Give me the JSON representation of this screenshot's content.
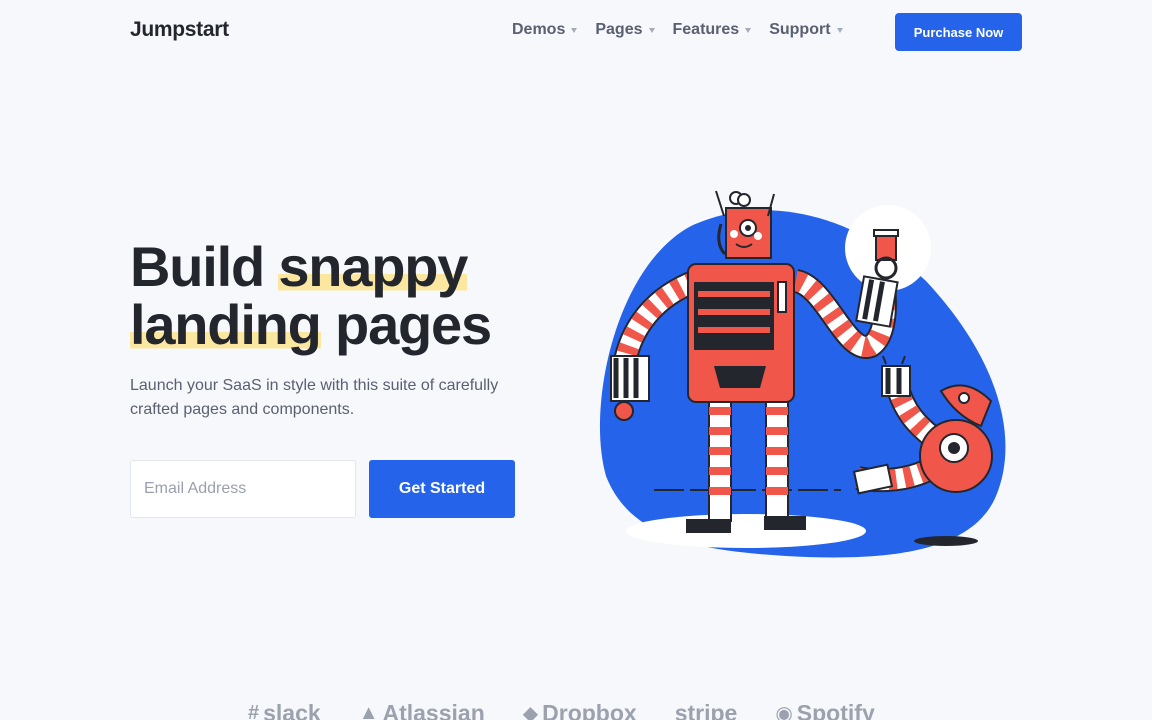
{
  "header": {
    "logo": "Jumpstart",
    "nav": [
      {
        "label": "Demos"
      },
      {
        "label": "Pages"
      },
      {
        "label": "Features"
      },
      {
        "label": "Support"
      }
    ],
    "cta_label": "Purchase Now"
  },
  "hero": {
    "title_line1_plain": "Build ",
    "title_line1_highlight": "snappy",
    "title_line2_highlight": "landing",
    "title_line2_plain": " pages",
    "subtitle": "Launch your SaaS in style with this suite of carefully crafted pages and components.",
    "email_placeholder": "Email Address",
    "email_value": "",
    "cta_label": "Get Started"
  },
  "logos": [
    {
      "name": "slack",
      "icon": "slack-icon"
    },
    {
      "name": "Atlassian",
      "icon": "atlassian-icon"
    },
    {
      "name": "Dropbox",
      "icon": "dropbox-icon"
    },
    {
      "name": "stripe",
      "icon": ""
    },
    {
      "name": "Spotify",
      "icon": "spotify-icon"
    }
  ],
  "colors": {
    "accent": "#2563eb",
    "highlight": "#fce7a0",
    "robot": "#f0564a",
    "background": "#f7f8fc"
  },
  "illustration": {
    "icon": "robot-illustration"
  }
}
